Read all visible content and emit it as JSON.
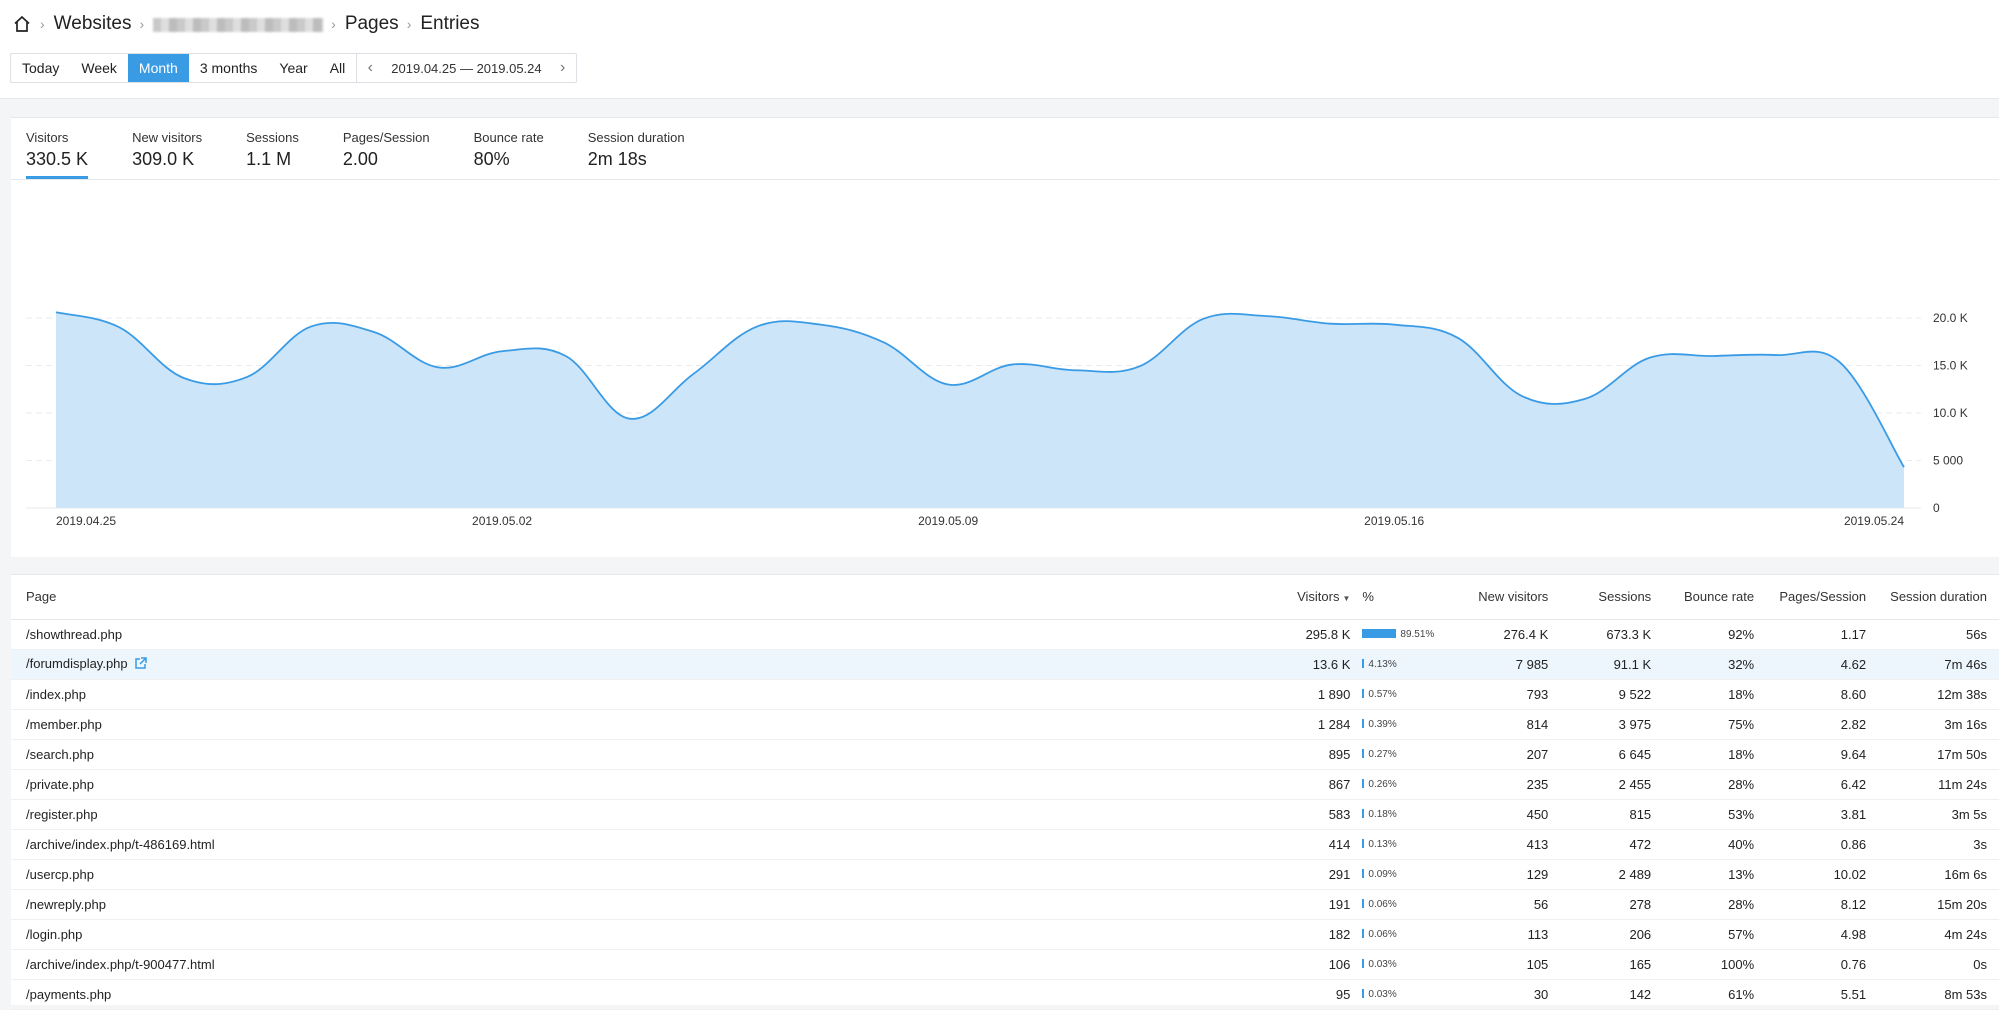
{
  "breadcrumb": {
    "websites": "Websites",
    "pages": "Pages",
    "entries": "Entries"
  },
  "periods": [
    {
      "label": "Today",
      "active": false
    },
    {
      "label": "Week",
      "active": false
    },
    {
      "label": "Month",
      "active": true
    },
    {
      "label": "3 months",
      "active": false
    },
    {
      "label": "Year",
      "active": false
    },
    {
      "label": "All",
      "active": false
    }
  ],
  "date_range": "2019.04.25 — 2019.05.24",
  "accent_color": "#3a9be5",
  "metrics": [
    {
      "label": "Visitors",
      "value": "330.5 K",
      "active": true
    },
    {
      "label": "New visitors",
      "value": "309.0 K",
      "active": false
    },
    {
      "label": "Sessions",
      "value": "1.1 M",
      "active": false
    },
    {
      "label": "Pages/Session",
      "value": "2.00",
      "active": false
    },
    {
      "label": "Bounce rate",
      "value": "80%",
      "active": false
    },
    {
      "label": "Session duration",
      "value": "2m 18s",
      "active": false
    }
  ],
  "chart_data": {
    "type": "area",
    "ylim": [
      0,
      20000
    ],
    "y_ticks": [
      "0",
      "5 000",
      "10.0 K",
      "15.0 K",
      "20.0 K"
    ],
    "y_tick_values": [
      0,
      5000,
      10000,
      15000,
      20000
    ],
    "x_tick_labels": [
      "2019.04.25",
      "2019.05.02",
      "2019.05.09",
      "2019.05.16",
      "2019.05.24"
    ],
    "x_tick_index": [
      0,
      7,
      14,
      21,
      29
    ],
    "grid": true,
    "series": [
      {
        "values": [
          20600,
          19000,
          13700,
          13800,
          19100,
          18500,
          14800,
          16500,
          16000,
          9400,
          14100,
          19100,
          19300,
          17400,
          13000,
          15100,
          14500,
          14900,
          19900,
          20200,
          19400,
          19300,
          17900,
          11800,
          11500,
          15800,
          16000,
          16100,
          15300,
          4300
        ]
      }
    ]
  },
  "table": {
    "columns": [
      "Page",
      "Visitors",
      "%",
      "New visitors",
      "Sessions",
      "Bounce rate",
      "Pages/Session",
      "Session duration"
    ],
    "rows": [
      {
        "page": "/showthread.php",
        "visitors": "295.8 K",
        "pct": "89.51%",
        "pct_value": 89.51,
        "new_visitors": "276.4 K",
        "sessions": "673.3 K",
        "bounce": "92%",
        "pps": "1.17",
        "duration": "56s"
      },
      {
        "page": "/forumdisplay.php",
        "visitors": "13.6 K",
        "pct": "4.13%",
        "pct_value": 4.13,
        "new_visitors": "7 985",
        "sessions": "91.1 K",
        "bounce": "32%",
        "pps": "4.62",
        "duration": "7m 46s",
        "highlighted": true
      },
      {
        "page": "/index.php",
        "visitors": "1 890",
        "pct": "0.57%",
        "pct_value": 0.57,
        "new_visitors": "793",
        "sessions": "9 522",
        "bounce": "18%",
        "pps": "8.60",
        "duration": "12m 38s"
      },
      {
        "page": "/member.php",
        "visitors": "1 284",
        "pct": "0.39%",
        "pct_value": 0.39,
        "new_visitors": "814",
        "sessions": "3 975",
        "bounce": "75%",
        "pps": "2.82",
        "duration": "3m 16s"
      },
      {
        "page": "/search.php",
        "visitors": "895",
        "pct": "0.27%",
        "pct_value": 0.27,
        "new_visitors": "207",
        "sessions": "6 645",
        "bounce": "18%",
        "pps": "9.64",
        "duration": "17m 50s"
      },
      {
        "page": "/private.php",
        "visitors": "867",
        "pct": "0.26%",
        "pct_value": 0.26,
        "new_visitors": "235",
        "sessions": "2 455",
        "bounce": "28%",
        "pps": "6.42",
        "duration": "11m 24s"
      },
      {
        "page": "/register.php",
        "visitors": "583",
        "pct": "0.18%",
        "pct_value": 0.18,
        "new_visitors": "450",
        "sessions": "815",
        "bounce": "53%",
        "pps": "3.81",
        "duration": "3m 5s"
      },
      {
        "page": "/archive/index.php/t-486169.html",
        "visitors": "414",
        "pct": "0.13%",
        "pct_value": 0.13,
        "new_visitors": "413",
        "sessions": "472",
        "bounce": "40%",
        "pps": "0.86",
        "duration": "3s"
      },
      {
        "page": "/usercp.php",
        "visitors": "291",
        "pct": "0.09%",
        "pct_value": 0.09,
        "new_visitors": "129",
        "sessions": "2 489",
        "bounce": "13%",
        "pps": "10.02",
        "duration": "16m 6s"
      },
      {
        "page": "/newreply.php",
        "visitors": "191",
        "pct": "0.06%",
        "pct_value": 0.06,
        "new_visitors": "56",
        "sessions": "278",
        "bounce": "28%",
        "pps": "8.12",
        "duration": "15m 20s"
      },
      {
        "page": "/login.php",
        "visitors": "182",
        "pct": "0.06%",
        "pct_value": 0.06,
        "new_visitors": "113",
        "sessions": "206",
        "bounce": "57%",
        "pps": "4.98",
        "duration": "4m 24s"
      },
      {
        "page": "/archive/index.php/t-900477.html",
        "visitors": "106",
        "pct": "0.03%",
        "pct_value": 0.03,
        "new_visitors": "105",
        "sessions": "165",
        "bounce": "100%",
        "pps": "0.76",
        "duration": "0s"
      },
      {
        "page": "/payments.php",
        "visitors": "95",
        "pct": "0.03%",
        "pct_value": 0.03,
        "new_visitors": "30",
        "sessions": "142",
        "bounce": "61%",
        "pps": "5.51",
        "duration": "8m 53s"
      }
    ]
  }
}
